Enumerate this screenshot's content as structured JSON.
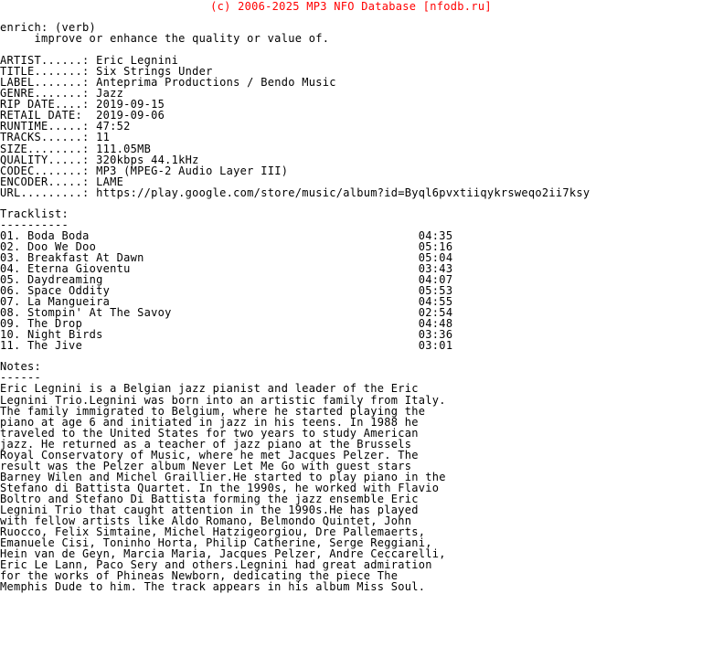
{
  "header": {
    "copyright_line": "(c) 2006-2025 MP3 NFO Database [nfodb.ru]",
    "color": "#ff0000"
  },
  "definition": {
    "word_line": "enrich: (verb)",
    "meaning_line": "     improve or enhance the quality or value of."
  },
  "metadata": {
    "labels": [
      "ARTIST",
      "TITLE",
      "LABEL",
      "GENRE",
      "RIP DATE",
      "RETAIL DATE",
      "RUNTIME",
      "TRACKS",
      "SIZE",
      "QUALITY",
      "CODEC",
      "ENCODER",
      "URL"
    ],
    "rows": [
      {
        "label": "ARTIST......:",
        "value": "Eric Legnini"
      },
      {
        "label": "TITLE.......:",
        "value": "Six Strings Under"
      },
      {
        "label": "LABEL.......:",
        "value": "Anteprima Productions / Bendo Music"
      },
      {
        "label": "GENRE.......:",
        "value": "Jazz"
      },
      {
        "label": "RIP DATE....:",
        "value": "2019-09-15"
      },
      {
        "label": "RETAIL DATE:",
        "value": "2019-09-06"
      },
      {
        "label": "RUNTIME.....:",
        "value": "47:52"
      },
      {
        "label": "TRACKS......:",
        "value": "11"
      },
      {
        "label": "SIZE........:",
        "value": "111.05MB"
      },
      {
        "label": "QUALITY.....:",
        "value": "320kbps 44.1kHz"
      },
      {
        "label": "CODEC.......:",
        "value": "MP3 (MPEG-2 Audio Layer III)"
      },
      {
        "label": "ENCODER.....:",
        "value": "LAME"
      },
      {
        "label": "URL.........:",
        "value": "https://play.google.com/store/music/album?id=Byql6pvxtiiqykrsweqo2ii7ksy"
      }
    ]
  },
  "tracklist": {
    "heading": "Tracklist:",
    "underline": "----------",
    "tracks": [
      {
        "num": "01.",
        "title": "Boda Boda",
        "time": "04:35"
      },
      {
        "num": "02.",
        "title": "Doo We Doo",
        "time": "05:16"
      },
      {
        "num": "03.",
        "title": "Breakfast At Dawn",
        "time": "05:04"
      },
      {
        "num": "04.",
        "title": "Eterna Gioventu",
        "time": "03:43"
      },
      {
        "num": "05.",
        "title": "Daydreaming",
        "time": "04:07"
      },
      {
        "num": "06.",
        "title": "Space Oddity",
        "time": "05:53"
      },
      {
        "num": "07.",
        "title": "La Mangueira",
        "time": "04:55"
      },
      {
        "num": "08.",
        "title": "Stompin' At The Savoy",
        "time": "02:54"
      },
      {
        "num": "09.",
        "title": "The Drop",
        "time": "04:48"
      },
      {
        "num": "10.",
        "title": "Night Birds",
        "time": "03:36"
      },
      {
        "num": "11.",
        "title": "The Jive",
        "time": "03:01"
      }
    ]
  },
  "notes": {
    "heading": "Notes:",
    "underline": "------",
    "lines": [
      "Eric Legnini is a Belgian jazz pianist and leader of the Eric",
      "Legnini Trio.Legnini was born into an artistic family from Italy.",
      "The family immigrated to Belgium, where he started playing the",
      "piano at age 6 and initiated in jazz in his teens. In 1988 he",
      "traveled to the United States for two years to study American",
      "jazz. He returned as a teacher of jazz piano at the Brussels",
      "Royal Conservatory of Music, where he met Jacques Pelzer. The",
      "result was the Pelzer album Never Let Me Go with guest stars",
      "Barney Wilen and Michel Graillier.He started to play piano in the",
      "Stefano di Battista Quartet. In the 1990s, he worked with Flavio",
      "Boltro and Stefano Di Battista forming the jazz ensemble Eric",
      "Legnini Trio that caught attention in the 1990s.He has played",
      "with fellow artists like Aldo Romano, Belmondo Quintet, John",
      "Ruocco, Felix Simtaine, Michel Hatzigeorgiou, Dre Pallemaerts,",
      "Emanuele Cisi, Toninho Horta, Philip Catherine, Serge Reggiani,",
      "Hein van de Geyn, Marcia Maria, Jacques Pelzer, Andre Ceccarelli,",
      "Eric Le Lann, Paco Sery and others.Legnini had great admiration",
      "for the works of Phineas Newborn, dedicating the piece The",
      "Memphis Dude to him. The track appears in his album Miss Soul."
    ]
  }
}
